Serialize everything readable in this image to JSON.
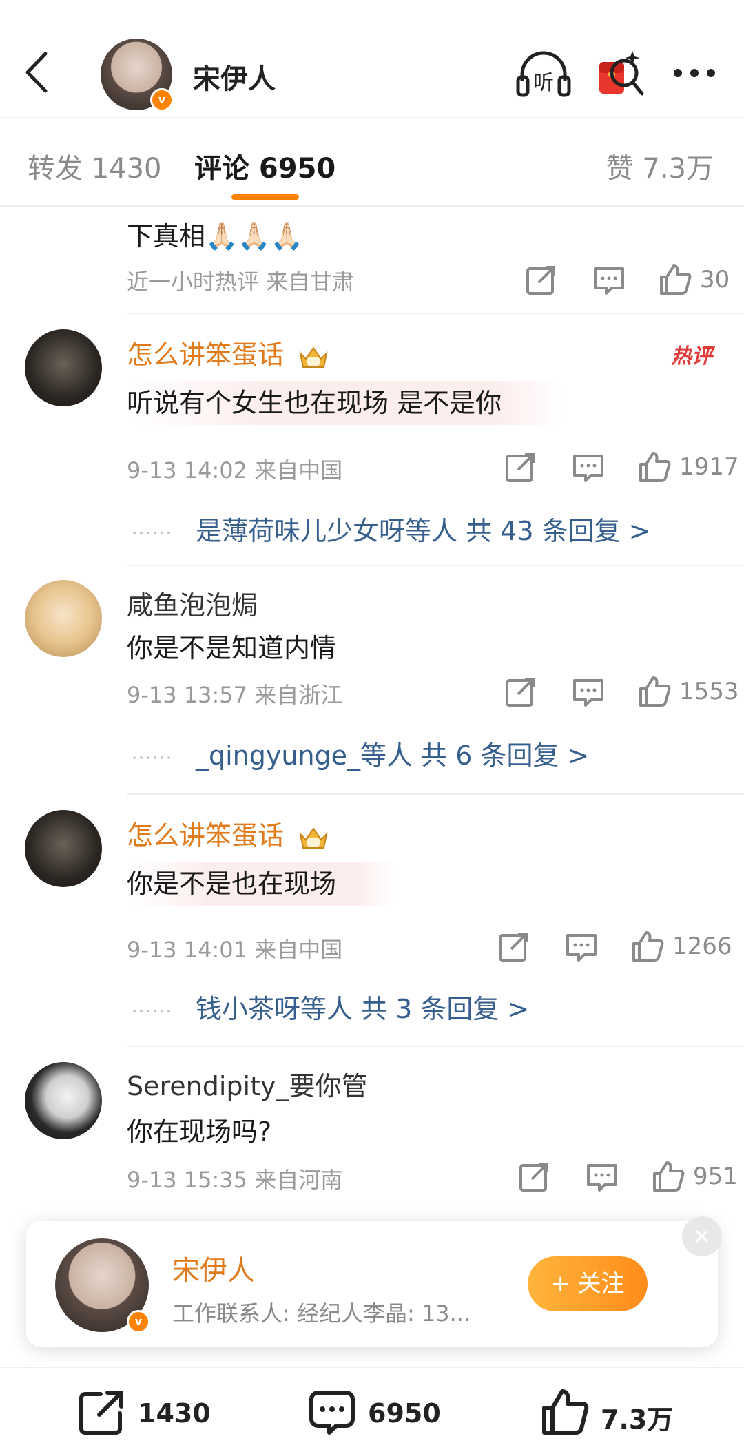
{
  "header": {
    "name": "宋伊人",
    "avatar_icon": "user-avatar",
    "icons": [
      "back-icon",
      "listen-icon",
      "red-packet-icon",
      "more-icon"
    ],
    "listen_label": "听"
  },
  "tabs": {
    "repost": "转发 1430",
    "comment": "评论 6950",
    "like": "赞 7.3万"
  },
  "comments": [
    {
      "text": "下真相🙏🏻🙏🏻🙏🏻",
      "meta": "近一小时热评  来自甘肃",
      "likes": "30"
    },
    {
      "name": "怎么讲笨蛋话",
      "text": "听说有个女生也在现场 是不是你",
      "meta": "9-13 14:02  来自中国",
      "likes": "1917",
      "hot_tag": "热评",
      "replies": "是薄荷味儿少女呀等人  共 43 条回复 >"
    },
    {
      "name": "咸鱼泡泡焗",
      "text": "你是不是知道内情",
      "meta": "9-13 13:57  来自浙江",
      "likes": "1553",
      "replies": "_qingyunge_等人  共 6 条回复 >"
    },
    {
      "name": "怎么讲笨蛋话",
      "text": "你是不是也在现场",
      "meta": "9-13 14:01  来自中国",
      "likes": "1266",
      "replies": "钱小茶呀等人  共 3 条回复 >"
    },
    {
      "name": "Serendipity_要你管",
      "text": "你在现场吗?",
      "meta": "9-13 15:35  来自河南",
      "likes": "951"
    }
  ],
  "banner": {
    "name": "宋伊人",
    "desc": "工作联系人: 经纪人李晶: 13...",
    "follow": "+ 关注",
    "badge": "v"
  },
  "bottom": {
    "repost": "1430",
    "comment": "6950",
    "like": "7.3万"
  },
  "colors": {
    "accent": "#ff8200",
    "vip_name": "#e07a1a",
    "reply_link": "#365f8e",
    "hot_tag": "#e23b3b"
  }
}
